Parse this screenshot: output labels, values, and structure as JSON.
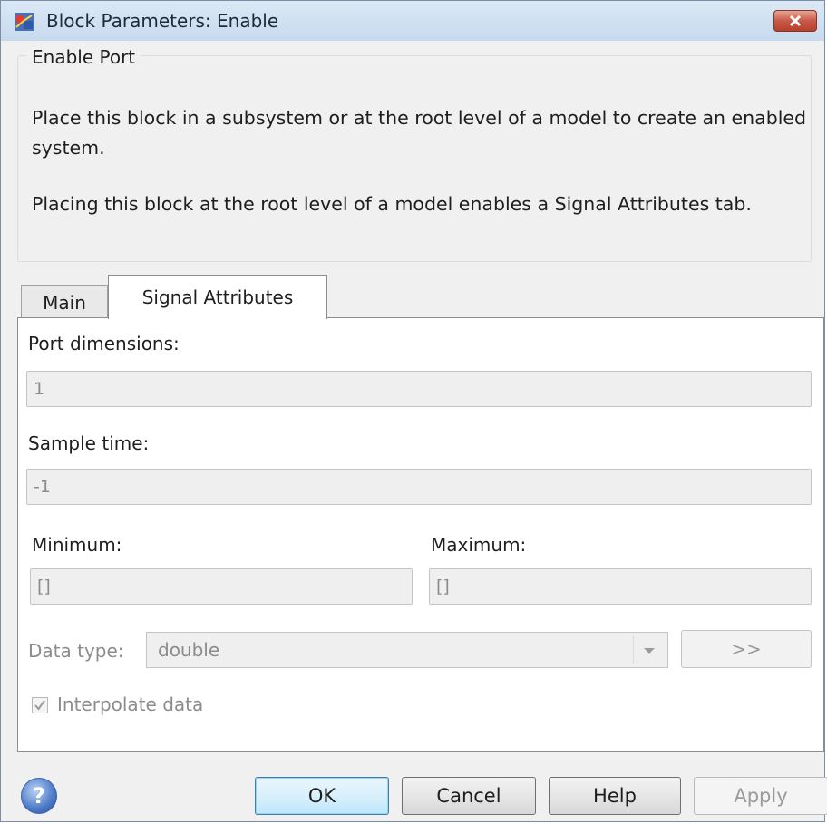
{
  "window": {
    "title": "Block Parameters: Enable"
  },
  "group": {
    "title": "Enable Port",
    "description_1": "Place this block in a subsystem or at the root level of a model to create an enabled system.",
    "description_2": "Placing this block at the root level of a model enables a Signal Attributes tab."
  },
  "tabs": [
    {
      "label": "Main",
      "active": false
    },
    {
      "label": "Signal Attributes",
      "active": true
    }
  ],
  "fields": {
    "port_dimensions": {
      "label": "Port dimensions:",
      "value": "1"
    },
    "sample_time": {
      "label": "Sample time:",
      "value": "-1"
    },
    "minimum": {
      "label": "Minimum:",
      "value": "[]"
    },
    "maximum": {
      "label": "Maximum:",
      "value": "[]"
    },
    "data_type": {
      "label": "Data type:",
      "value": "double",
      "expand_label": ">>"
    },
    "interpolate": {
      "label": "Interpolate data",
      "checked": true
    }
  },
  "buttons": {
    "ok": "OK",
    "cancel": "Cancel",
    "help": "Help",
    "apply": "Apply"
  },
  "icons": {
    "app": "simulink-block-icon",
    "close": "close-icon",
    "help": "question-icon",
    "dropdown": "chevron-down-icon"
  },
  "colors": {
    "close_button": "#c75a46",
    "ok_button_border": "#3c7fb1"
  }
}
